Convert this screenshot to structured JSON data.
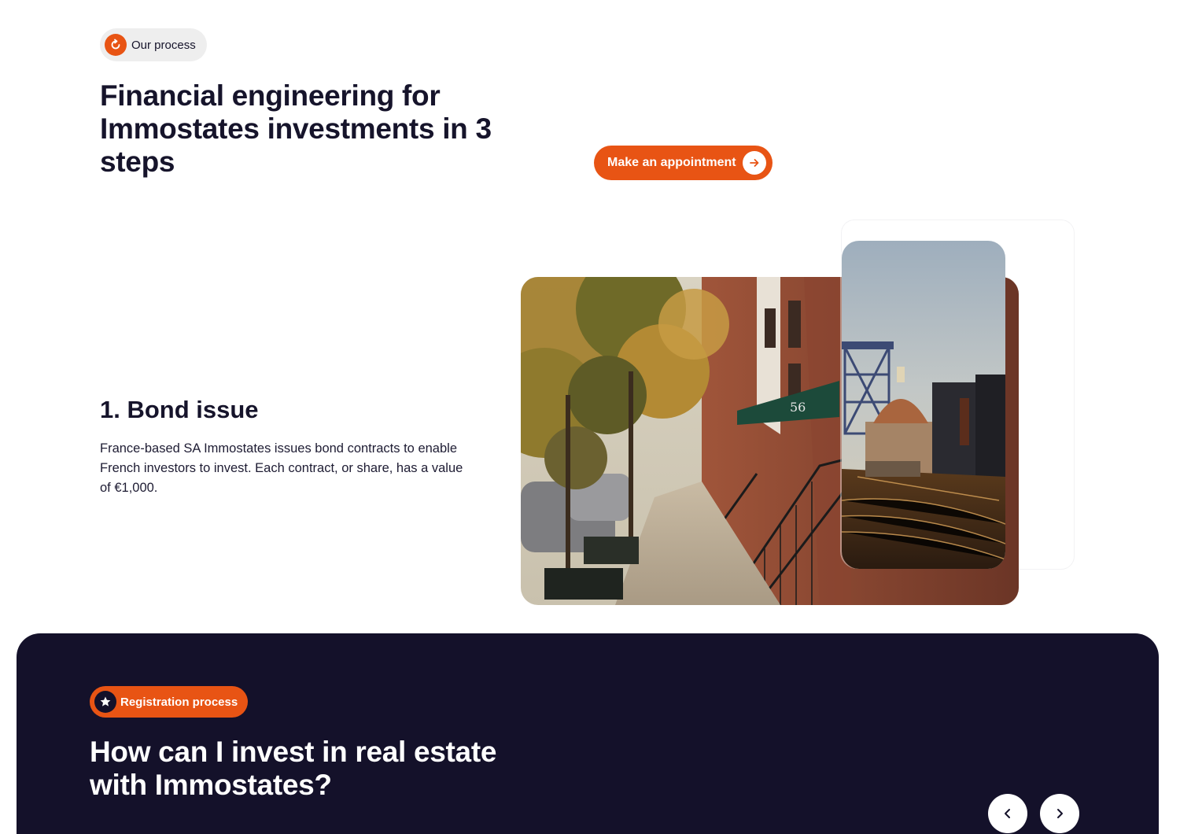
{
  "process_badge": {
    "label": "Our process",
    "icon": "refresh-icon"
  },
  "headline": "Financial engineering for Immostates investments in 3 steps",
  "cta": {
    "label": "Make an appointment",
    "icon": "arrow-right-icon"
  },
  "step": {
    "title": "1. Bond issue",
    "description": "France-based SA Immostates issues bond contracts to enable French investors to invest. Each contract, or share, has a value of €1,000."
  },
  "images": {
    "street": {
      "awning_number": "56"
    },
    "bridge": {}
  },
  "registration": {
    "badge_label": "Registration process",
    "badge_icon": "star-icon",
    "title": "How can I invest in real estate with Immostates?",
    "prev_icon": "chevron-left-icon",
    "next_icon": "chevron-right-icon"
  },
  "colors": {
    "accent": "#e85414",
    "dark": "#14112a",
    "text": "#16142b",
    "badge_bg": "#eeeeee"
  }
}
